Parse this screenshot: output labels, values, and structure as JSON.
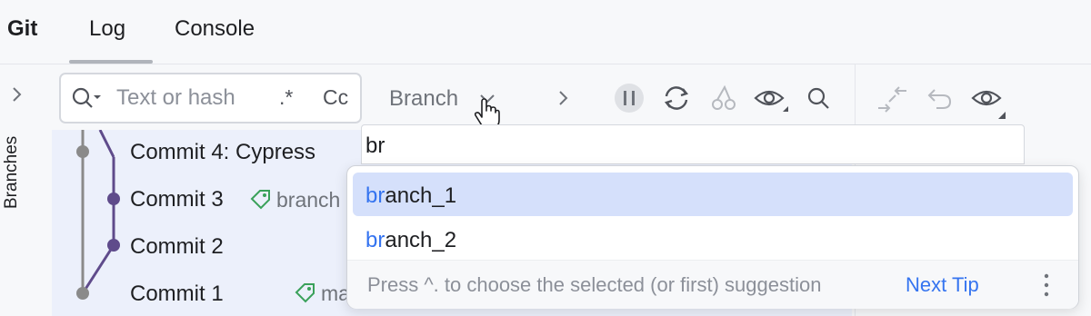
{
  "header": {
    "tool_title": "Git",
    "tabs": [
      {
        "label": "Log",
        "active": true
      },
      {
        "label": "Console",
        "active": false
      }
    ]
  },
  "sidebar": {
    "expand_icon": "chevron-right-icon",
    "vertical_label": "Branches"
  },
  "search": {
    "placeholder": "Text or hash",
    "regex_label": ".*",
    "case_label": "Cc"
  },
  "toolbar": {
    "branch_filter_label": "Branch",
    "icons": [
      "chevron-down-icon",
      "chevron-right-icon",
      "pause-icon",
      "refresh-icon",
      "cherry-pick-icon",
      "eye-icon",
      "search-icon"
    ]
  },
  "right_toolbar": {
    "icons": [
      "collapse-arrows-icon",
      "undo-icon",
      "eye-icon"
    ]
  },
  "log": {
    "commits": [
      {
        "message": "Commit 4: Cypress",
        "ref": ""
      },
      {
        "message": "Commit 3",
        "ref": "branch"
      },
      {
        "message": "Commit 2",
        "ref": ""
      },
      {
        "message": "Commit 1",
        "ref": "ma"
      }
    ]
  },
  "popup": {
    "typed_text": "br",
    "suggestions": [
      {
        "match": "br",
        "rest": "anch_1",
        "selected": true
      },
      {
        "match": "br",
        "rest": "anch_2",
        "selected": false
      }
    ],
    "footer_hint": "Press ^. to choose the selected (or first) suggestion",
    "next_tip_label": "Next Tip",
    "more_icon": "kebab-menu-icon"
  },
  "colors": {
    "accent": "#3574f0",
    "graph_purple": "#5f4b8b",
    "graph_gray": "#8a8a8a",
    "selection": "#d5e0fb",
    "log_background": "#ecf0fb"
  }
}
